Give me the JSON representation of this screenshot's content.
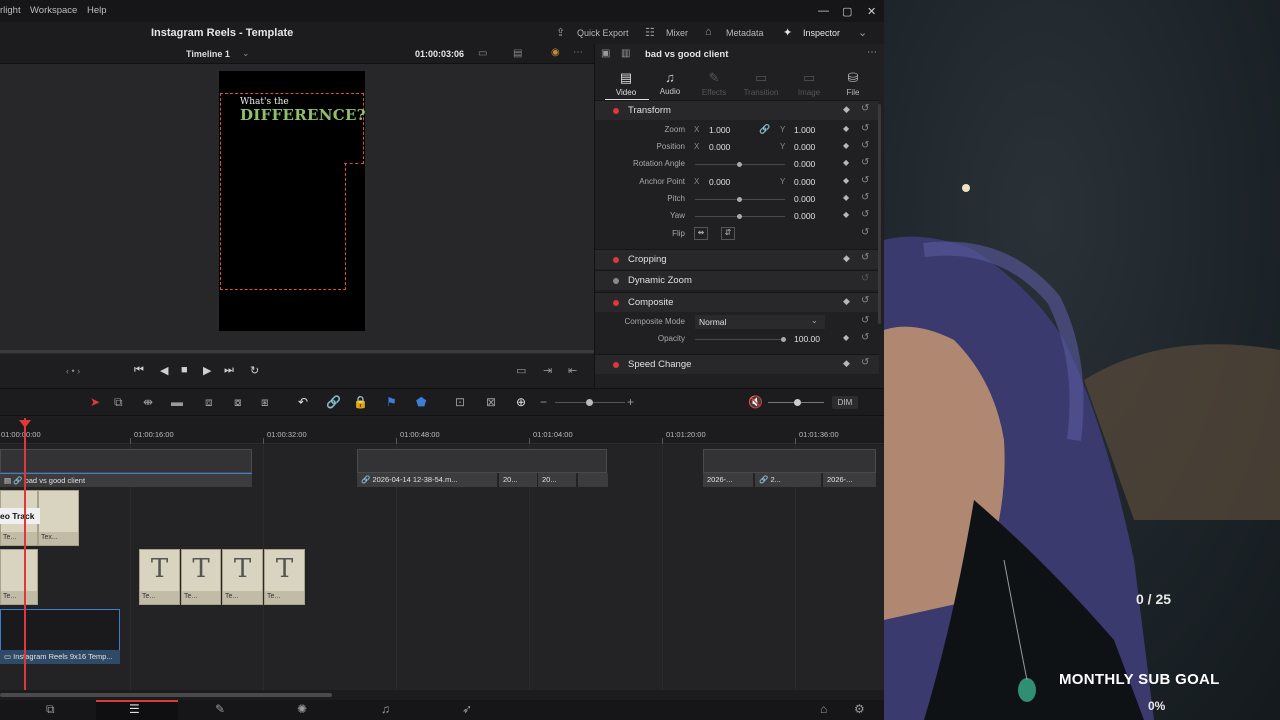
{
  "menu": {
    "items": [
      "rlight",
      "Workspace",
      "Help"
    ]
  },
  "window": {
    "title": "Instagram Reels - Template"
  },
  "toolbar": {
    "quick_export": "Quick Export",
    "mixer": "Mixer",
    "metadata": "Metadata",
    "inspector": "Inspector"
  },
  "viewer": {
    "timeline_name": "Timeline 1",
    "timecode": "01:00:03:06",
    "preview_line1": "What's the",
    "preview_line2": "DIFFERENCE?"
  },
  "inspector": {
    "clip_name": "bad vs good client",
    "tabs": [
      "Video",
      "Audio",
      "Effects",
      "Transition",
      "Image",
      "File"
    ],
    "active_tab": "Video",
    "sections": {
      "transform": "Transform",
      "cropping": "Cropping",
      "dynamic_zoom": "Dynamic Zoom",
      "composite": "Composite",
      "speed_change": "Speed Change"
    },
    "zoom_label": "Zoom",
    "zoom_x": "1.000",
    "zoom_y": "1.000",
    "position_label": "Position",
    "position_x": "0.000",
    "position_y": "0.000",
    "rotation_label": "Rotation Angle",
    "rotation": "0.000",
    "anchor_label": "Anchor Point",
    "anchor_x": "0.000",
    "anchor_y": "0.000",
    "pitch_label": "Pitch",
    "pitch": "0.000",
    "yaw_label": "Yaw",
    "yaw": "0.000",
    "flip_label": "Flip",
    "composite_mode_label": "Composite Mode",
    "composite_mode": "Normal",
    "opacity_label": "Opacity",
    "opacity": "100.00",
    "axis_x": "X",
    "axis_y": "Y"
  },
  "timeline": {
    "ruler": [
      "01:00:00:00",
      "01:00:16:00",
      "01:00:32:00",
      "01:00:48:00",
      "01:01:04:00",
      "01:01:20:00",
      "01:01:36:00"
    ],
    "audio_clip_main": "bad vs good client",
    "audio_clip_2": "2026-04-14 12-38-54.m...",
    "audio_clip_3": "20...",
    "audio_clip_4": "20...",
    "audio_clip_5": "2026-...",
    "audio_clip_6": "2...",
    "audio_clip_7": "2026-...",
    "track_tooltip": "eo Track",
    "text_clip_labels": [
      "Te...",
      "Tex...",
      "Te...",
      "Te...",
      "Te...",
      "Te...",
      "Te..."
    ],
    "video_clip": "Instagram Reels 9x16 Temp...",
    "dim_label": "DIM"
  },
  "overlay": {
    "goal_count": "0 / 25",
    "goal_label": "MONTHLY SUB GOAL",
    "goal_percent": "0%"
  },
  "colors": {
    "accent_red": "#e0383a",
    "guide_orange": "#d9552f",
    "title_green": "#8ec06b"
  }
}
